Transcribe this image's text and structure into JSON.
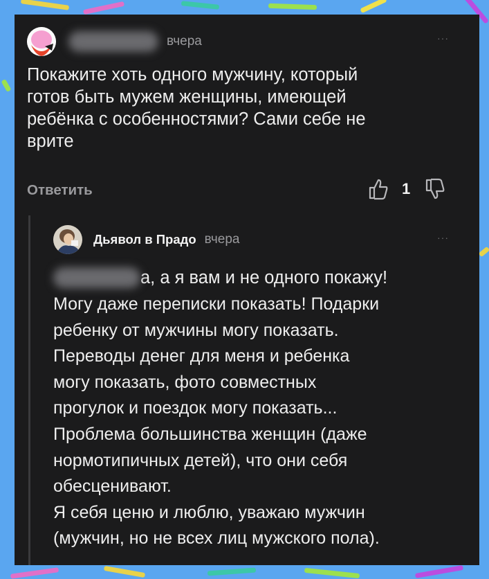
{
  "comment": {
    "author_hidden": true,
    "time": "вчера",
    "text": "Покажите хоть одного мужчину, который\nготов быть мужем женщины, имеющей\nребёнка с особенностями? Сами себе не\nврите",
    "reply_label": "Ответить",
    "rating": "1",
    "more": "···"
  },
  "reply": {
    "author": "Дьявол в Прадо",
    "time": "вчера",
    "more": "···",
    "first_line_visible": "а, а я вам и не одного покажу!",
    "text": "Могу даже переписки показать! Подарки\nребенку от мужчины могу показать.\nПереводы денег для меня и ребенка\nмогу показать, фото совместных\nпрогулок и поездок могу показать...\nПроблема большинства женщин (даже\nнормотипичных детей), что они себя\nобесценивают.\nЯ себя ценю и люблю, уважаю мужчин\n(мужчин, но не всех лиц мужского пола)."
  },
  "icons": {
    "upvote": "thumb-up-icon",
    "downvote": "thumb-down-icon",
    "more": "more-dots-icon"
  },
  "colors": {
    "background": "#5aa6f0",
    "card": "#1b1b1c",
    "text": "#eeeeee",
    "muted": "#9a9a9d"
  }
}
